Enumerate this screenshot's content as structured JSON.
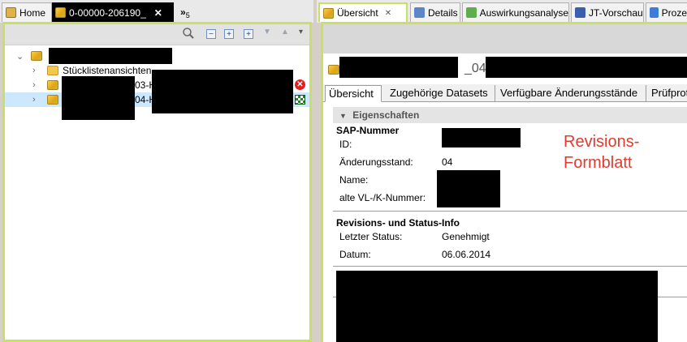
{
  "left": {
    "tabs": [
      {
        "label": "Home",
        "icon": "home-icon"
      },
      {
        "label": "0-00000-206190_",
        "icon": "bom-cubes-icon",
        "close": "✕"
      }
    ],
    "overflow": {
      "label": "»",
      "count": "5"
    },
    "tree": [
      {
        "label": "",
        "expanded": true
      },
      {
        "label": "Stücklistenansichten",
        "icon": "folder-icon"
      },
      {
        "label": "03-H",
        "status": "error"
      },
      {
        "label": "04-H",
        "status": "released",
        "selected": true
      }
    ]
  },
  "right": {
    "tabs": [
      {
        "label": "Übersicht",
        "close": "✕"
      },
      {
        "label": "Details"
      },
      {
        "label": "Auswirkungsanalyse"
      },
      {
        "label": "JT-Vorschau"
      },
      {
        "label": "Proze"
      }
    ],
    "title_fragment": "_04-",
    "subtabs": [
      "Übersicht",
      "Zugehörige Datasets",
      "Verfügbare Änderungsstände",
      "Prüfprot"
    ],
    "properties": {
      "header": "Eigenschaften",
      "sap_section": "SAP-Nummer",
      "id_label": "ID:",
      "aenderungsstand_label": "Änderungsstand:",
      "aenderungsstand_value": "04",
      "name_label": "Name:",
      "alte_nummer_label": "alte VL-/K-Nummer:",
      "revision_section": "Revisions- und Status-Info",
      "letzter_status_label": "Letzter Status:",
      "letzter_status_value": "Genehmigt",
      "datum_label": "Datum:",
      "datum_value": "06.06.2014"
    },
    "annotation": "Revisions- Formblatt"
  }
}
